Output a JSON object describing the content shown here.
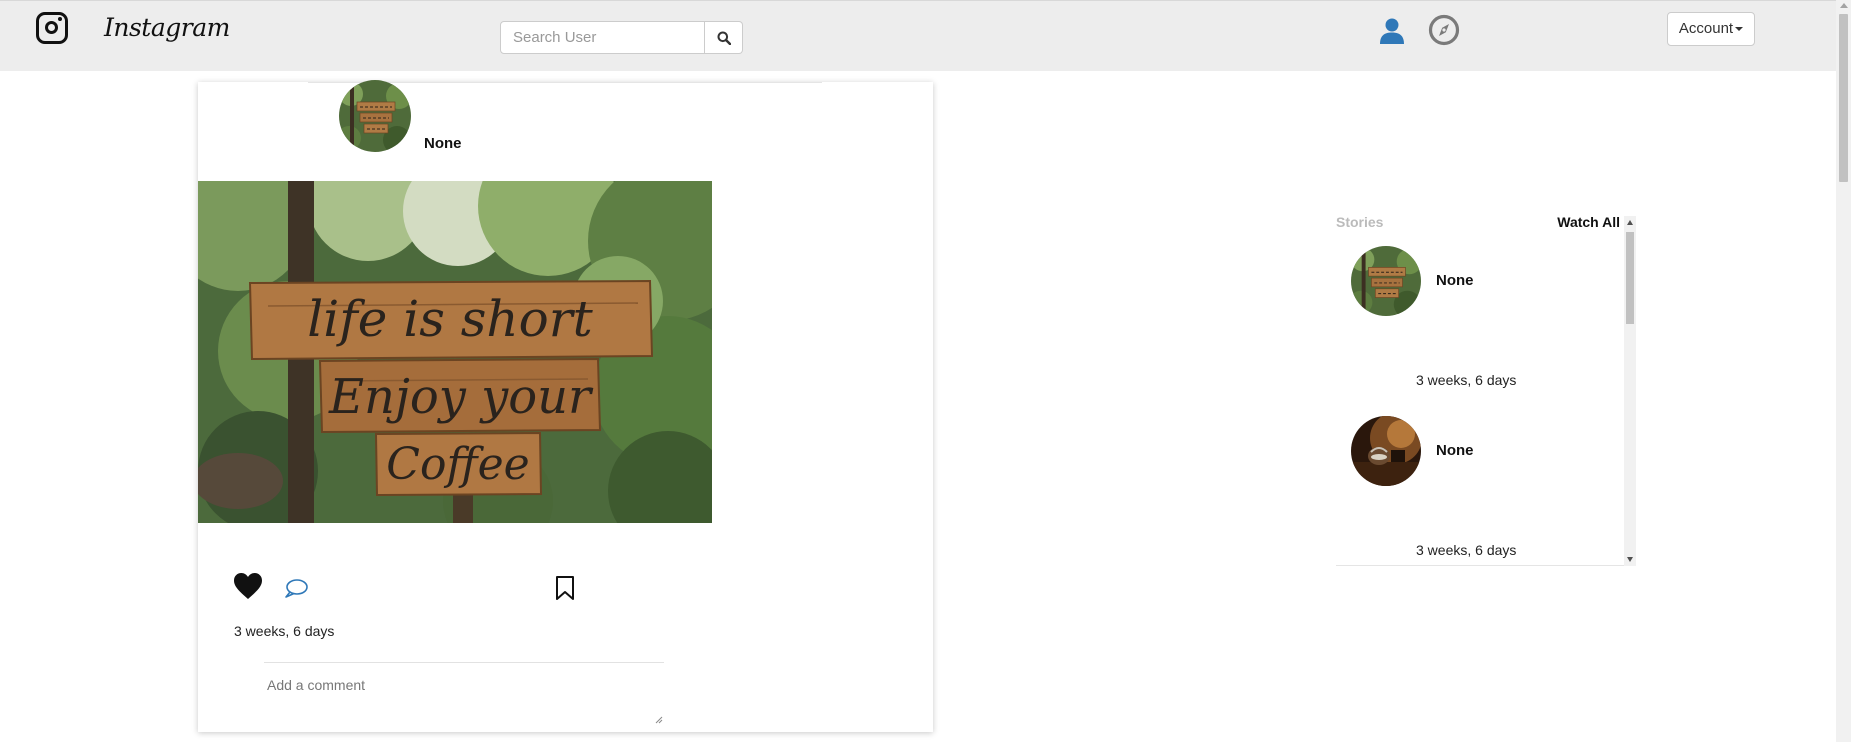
{
  "app": {
    "brand_name": "Instagram",
    "logo_icon": "instagram-camera-icon"
  },
  "nav": {
    "search_placeholder": "Search User",
    "search_icon": "search-icon",
    "profile_icon": "user-icon",
    "explore_icon": "compass-icon",
    "account_label": "Account",
    "colors": {
      "bar": "#ededed",
      "profile_icon": "#2f78b8",
      "explore_icon": "#7a7a7a"
    }
  },
  "post": {
    "username": "None",
    "image_text": "life is short Enjoy your Coffee",
    "liked": true,
    "time": "3 weeks, 6 days",
    "comment_placeholder": "Add a comment",
    "icons": {
      "like": "heart-icon",
      "comment": "comment-icon",
      "save": "bookmark-icon"
    }
  },
  "stories": {
    "title": "Stories",
    "watch_all_label": "Watch All",
    "items": [
      {
        "username": "None",
        "time": "3 weeks, 6 days"
      },
      {
        "username": "None",
        "time": "3 weeks, 6 days"
      }
    ]
  }
}
